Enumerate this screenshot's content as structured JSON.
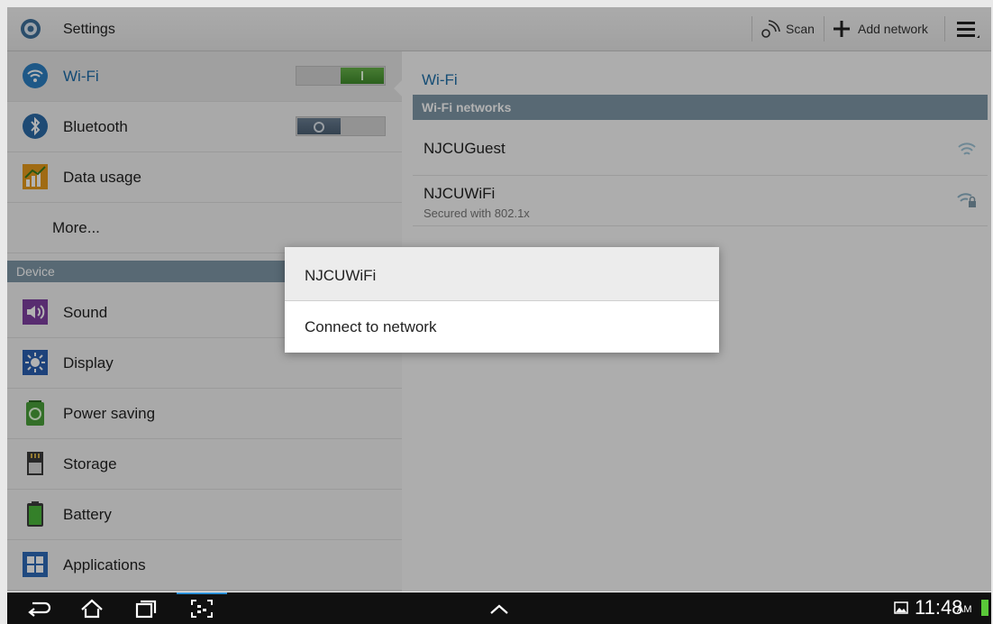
{
  "actionbar": {
    "title": "Settings",
    "scan_label": "Scan",
    "add_network_label": "Add network"
  },
  "sidebar": {
    "items": [
      {
        "label": "Wi-Fi",
        "toggle": "on"
      },
      {
        "label": "Bluetooth",
        "toggle": "off"
      },
      {
        "label": "Data usage"
      },
      {
        "label": "More..."
      }
    ],
    "device_header": "Device",
    "device_items": [
      {
        "label": "Sound"
      },
      {
        "label": "Display"
      },
      {
        "label": "Power saving"
      },
      {
        "label": "Storage"
      },
      {
        "label": "Battery"
      },
      {
        "label": "Applications"
      }
    ]
  },
  "wifi_panel": {
    "title": "Wi-Fi",
    "networks_header": "Wi-Fi networks",
    "networks": [
      {
        "ssid": "NJCUGuest",
        "subtitle": "",
        "secured": false
      },
      {
        "ssid": "NJCUWiFi",
        "subtitle": "Secured with 802.1x",
        "secured": true
      }
    ]
  },
  "dialog": {
    "title": "NJCUWiFi",
    "option": "Connect to network"
  },
  "statusbar": {
    "time": "11:48",
    "ampm": "AM"
  },
  "colors": {
    "accent_blue": "#1a6aa8",
    "section_header": "#7f97a6",
    "toggle_on": "#4f9e37",
    "system_bar": "#101010"
  }
}
